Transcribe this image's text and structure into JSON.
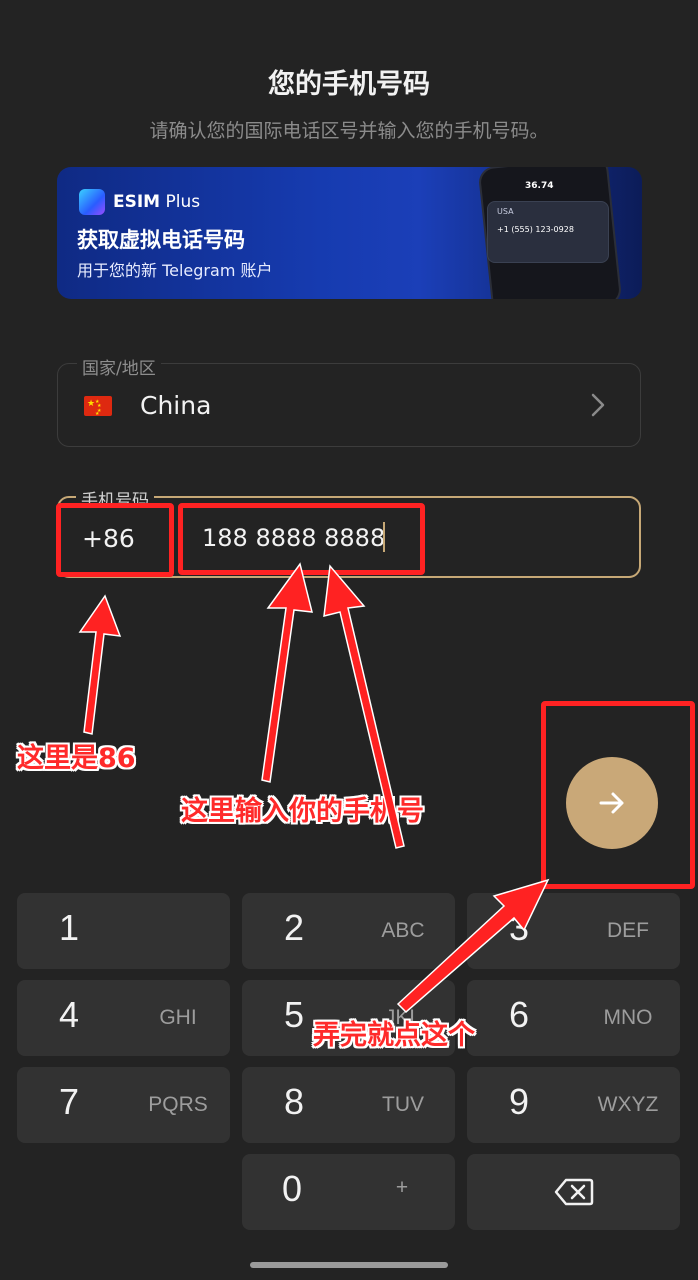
{
  "header": {
    "title": "您的手机号码",
    "subtitle": "请确认您的国际电话区号并输入您的手机号码。"
  },
  "banner": {
    "brand_bold": "ESIM",
    "brand_rest": " Plus",
    "headline": "获取虚拟电话号码",
    "subline": "用于您的新 Telegram 账户",
    "mock_balance": "36.74",
    "mock_country": "USA",
    "mock_number": "+1 (555) 123-0928"
  },
  "country": {
    "label": "国家/地区",
    "flag_icon": "china-flag-icon",
    "value": "China"
  },
  "phone": {
    "label": "手机号码",
    "country_code": "+86",
    "number": "188 8888 8888"
  },
  "annotations": {
    "cc_note": "这里是86",
    "phone_note": "这里输入你的手机号",
    "next_note": "弄完就点这个"
  },
  "next_button": {
    "icon": "arrow-right-icon",
    "color": "#c9a878"
  },
  "keypad": {
    "keys": [
      {
        "num": "1",
        "letters": ""
      },
      {
        "num": "2",
        "letters": "ABC"
      },
      {
        "num": "3",
        "letters": "DEF"
      },
      {
        "num": "4",
        "letters": "GHI"
      },
      {
        "num": "5",
        "letters": "JKL"
      },
      {
        "num": "6",
        "letters": "MNO"
      },
      {
        "num": "7",
        "letters": "PQRS"
      },
      {
        "num": "8",
        "letters": "TUV"
      },
      {
        "num": "9",
        "letters": "WXYZ"
      },
      {
        "num": "0",
        "letters": "+"
      }
    ],
    "backspace_icon": "backspace-icon"
  },
  "colors": {
    "background": "#232323",
    "accent_gold": "#c6a876",
    "annotation_red": "#ff2222"
  }
}
